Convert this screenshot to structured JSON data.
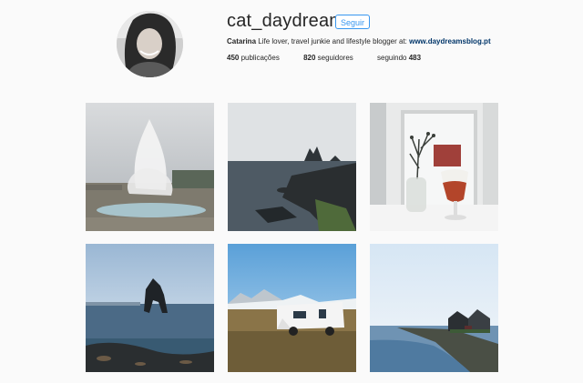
{
  "profile": {
    "username": "cat_daydreams",
    "follow_label": "Seguir",
    "bio_name": "Catarina",
    "bio_text": " Life lover, travel junkie and lifestyle blogger at: ",
    "bio_link": "www.daydreamsblog.pt"
  },
  "stats": {
    "posts_count": "450",
    "posts_label": " publicações",
    "followers_count": "820",
    "followers_label": " seguidores",
    "following_label": "seguindo ",
    "following_count": "483"
  },
  "posts": [
    {
      "subject": "geyser erupting"
    },
    {
      "subject": "rocky coastline with sea stacks"
    },
    {
      "subject": "window sill with flowers and glass"
    },
    {
      "subject": "sea stack rock in ocean"
    },
    {
      "subject": "camper van in field"
    },
    {
      "subject": "coastal houses by water"
    }
  ]
}
